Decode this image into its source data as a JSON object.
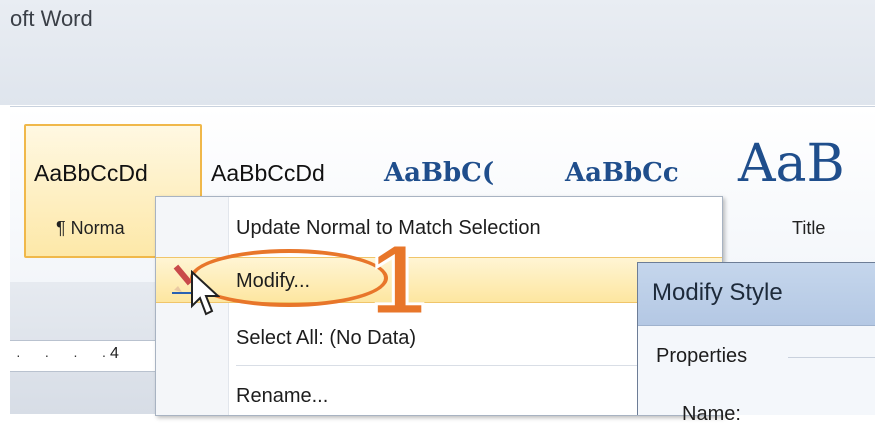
{
  "window": {
    "title": "oft Word"
  },
  "gallery": {
    "styles": [
      {
        "sample": "AaBbCcDd",
        "label": "¶ Norma"
      },
      {
        "sample": "AaBbCcDd",
        "label": ""
      },
      {
        "sample": "AaBbC(",
        "label": ""
      },
      {
        "sample": "AaBbCc",
        "label": ""
      },
      {
        "sample": "AaB",
        "label": "Title"
      }
    ]
  },
  "ruler": {
    "marks": "· · · ·",
    "number": "4"
  },
  "context_menu": {
    "items": [
      {
        "label": "Update Normal to Match Selection"
      },
      {
        "label": "Modify..."
      },
      {
        "label": "Select All: (No Data)"
      },
      {
        "label": "Rename..."
      }
    ]
  },
  "callout": {
    "number": "1"
  },
  "dialog": {
    "title": "Modify Style",
    "properties_label": "Properties",
    "name_label": "Name:"
  },
  "colors": {
    "callout": "#e8762a",
    "highlight": "#fde6a0",
    "heading": "#1f4e8c"
  }
}
